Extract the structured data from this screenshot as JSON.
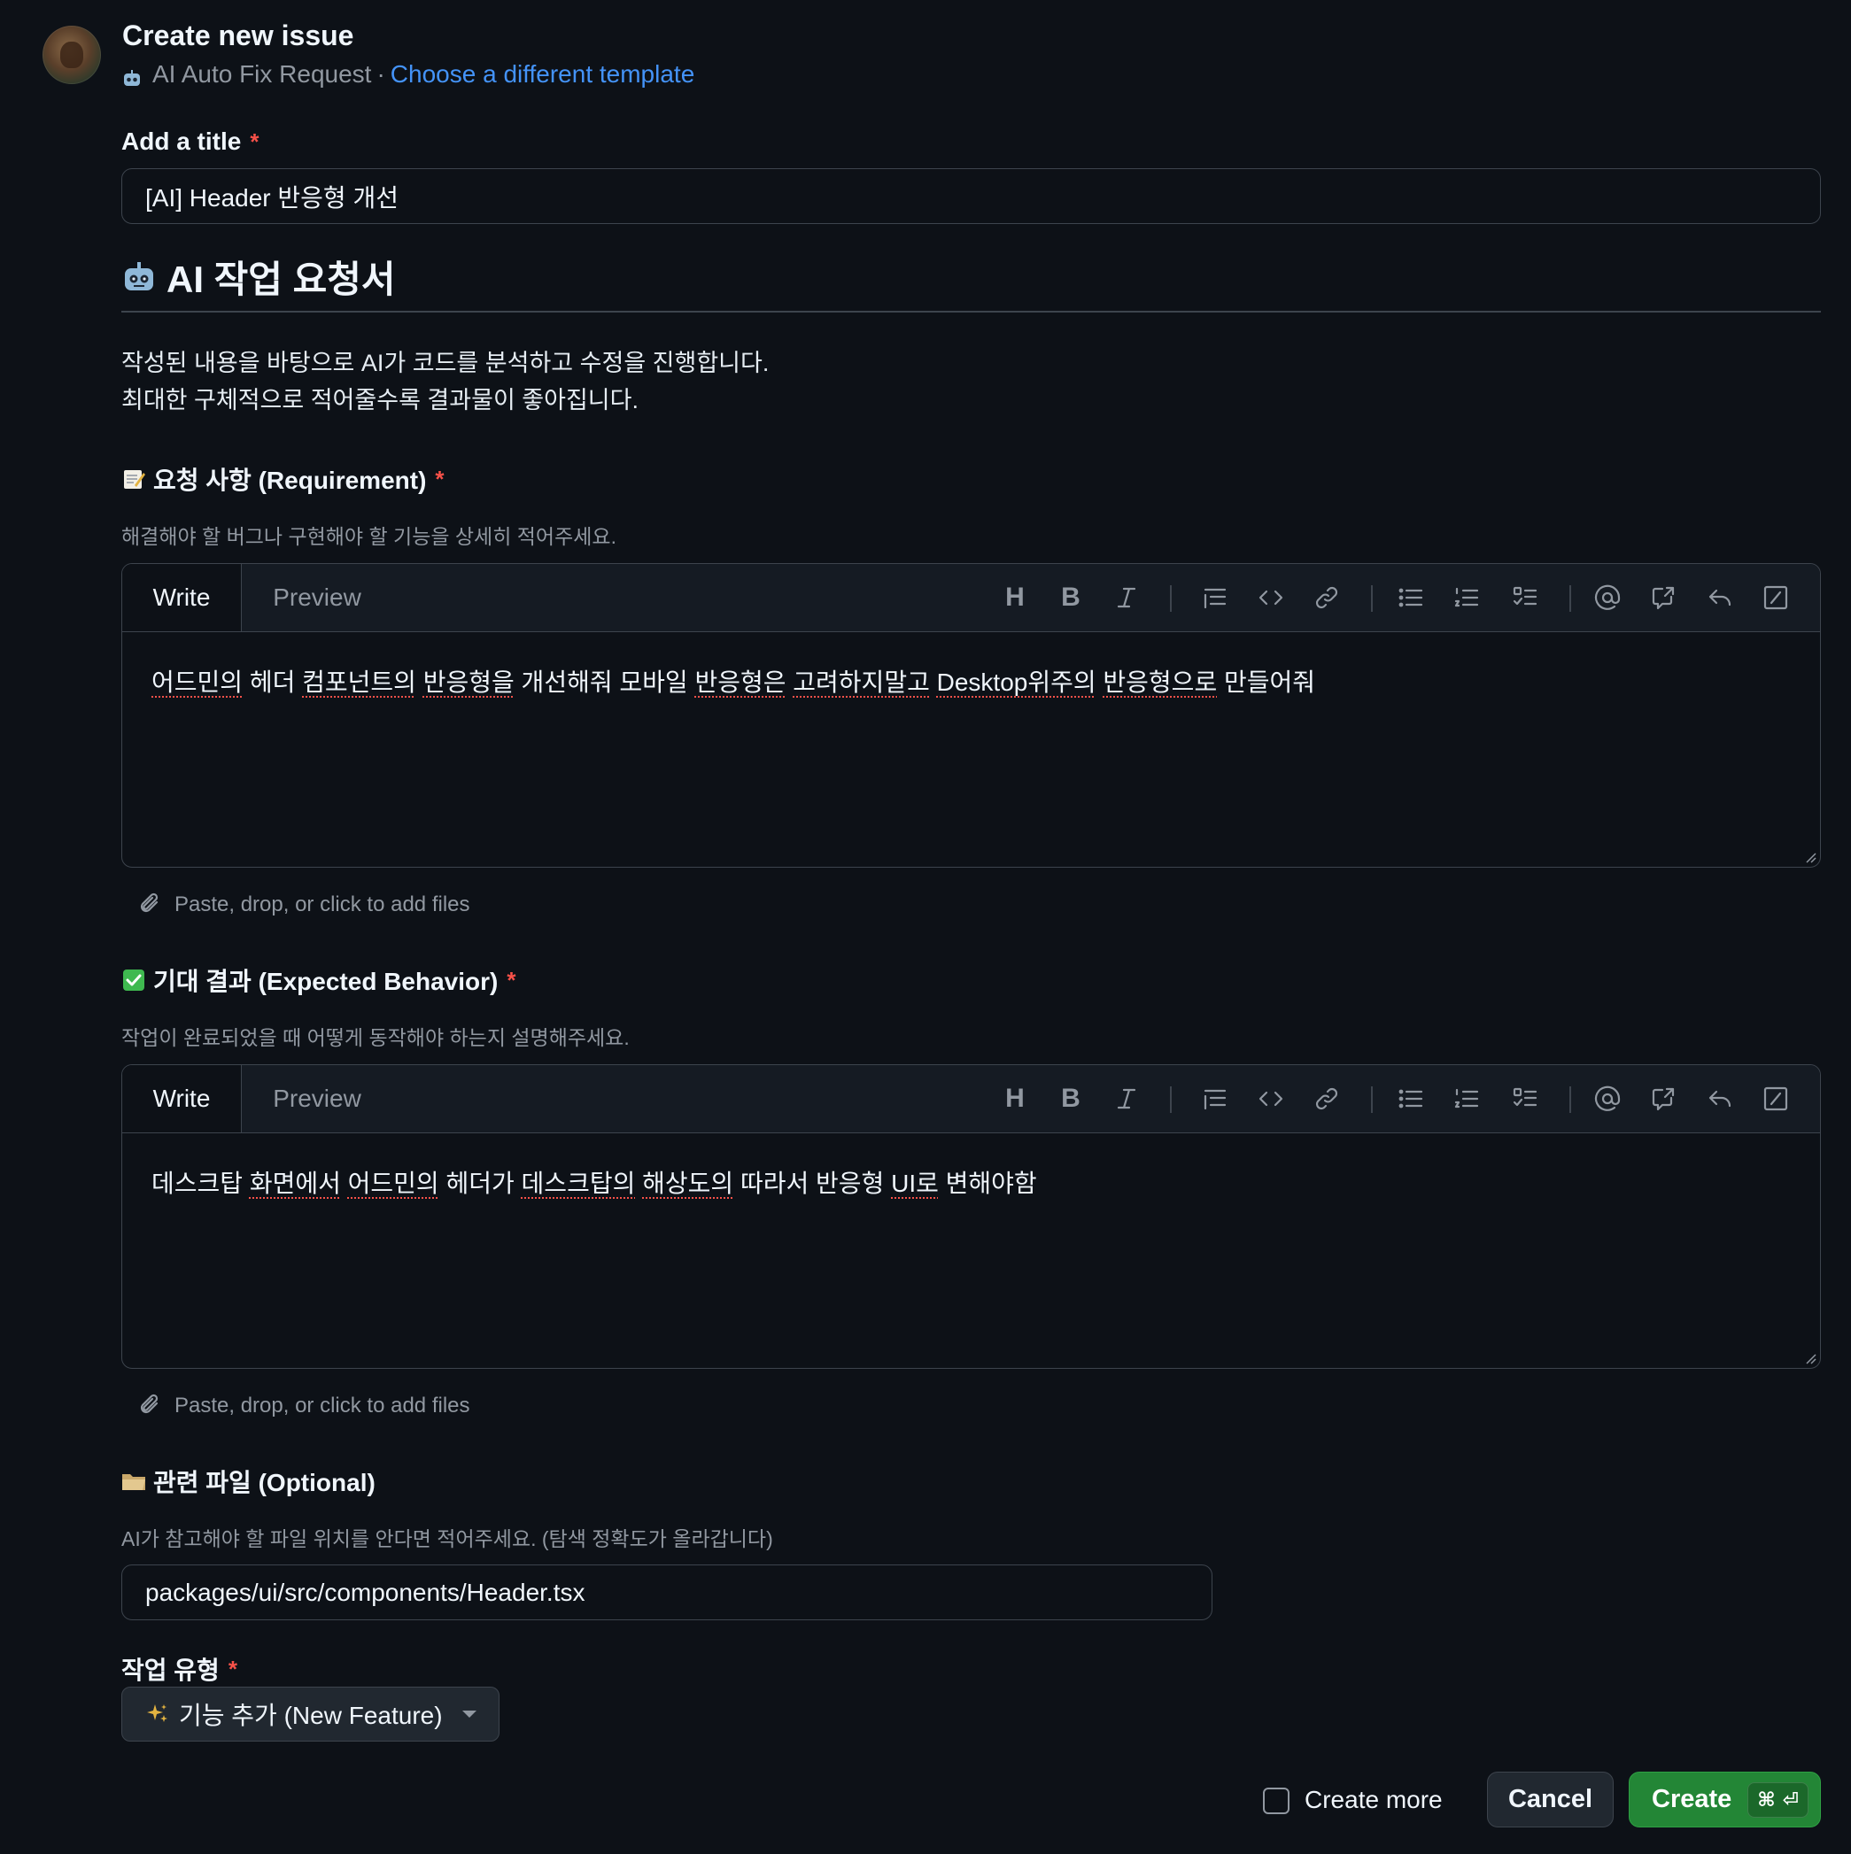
{
  "header": {
    "title": "Create new issue",
    "template_name": "AI Auto Fix Request",
    "separator": "·",
    "change_template_link": "Choose a different template"
  },
  "title_field": {
    "label": "Add a title",
    "required_mark": "*",
    "value": "[AI] Header 반응형 개선"
  },
  "intro": {
    "heading": "AI 작업 요청서",
    "line1": "작성된 내용을 바탕으로 AI가 코드를 분석하고 수정을 진행합니다.",
    "line2": "최대한 구체적으로 적어줄수록 결과물이 좋아집니다."
  },
  "requirement": {
    "label": "요청 사항 (Requirement)",
    "required_mark": "*",
    "hint": "해결해야 할 버그나 구현해야 할 기능을 상세히 적어주세요.",
    "tab_write": "Write",
    "tab_preview": "Preview",
    "body": {
      "w1": "어드민의",
      "w2": " 헤더 ",
      "w3": "컴포넌트의",
      "w4": " ",
      "w5": "반응형을",
      "w6": " 개선해줘 모바일 ",
      "w7": "반응형은",
      "w8": " ",
      "w9": "고려하지말고",
      "w10": " ",
      "w11": "Desktop위주의",
      "w12": " ",
      "w13": "반응형으로",
      "w14": " 만들어줘"
    },
    "attach_text": "Paste, drop, or click to add files"
  },
  "expected": {
    "label": "기대 결과 (Expected Behavior)",
    "required_mark": "*",
    "hint": "작업이 완료되었을 때 어떻게 동작해야 하는지 설명해주세요.",
    "tab_write": "Write",
    "tab_preview": "Preview",
    "body": {
      "w1": "데스크탑 ",
      "w2": "화면에서",
      "w3": " ",
      "w4": "어드민의",
      "w5": " 헤더가 ",
      "w6": "데스크탑의",
      "w7": " ",
      "w8": "해상도의",
      "w9": " 따라서 반응형 ",
      "w10": "UI로",
      "w11": " 변해야함"
    },
    "attach_text": "Paste, drop, or click to add files"
  },
  "files": {
    "label": "관련 파일 (Optional)",
    "hint": "AI가 참고해야 할 파일 위치를 안다면 적어주세요. (탐색 정확도가 올라갑니다)",
    "value": "packages/ui/src/components/Header.tsx"
  },
  "task_type": {
    "label": "작업 유형",
    "required_mark": "*",
    "selected": "기능 추가 (New Feature)"
  },
  "toolbar": {
    "heading": "H",
    "bold": "B"
  },
  "footer": {
    "create_more": "Create more",
    "cancel": "Cancel",
    "create": "Create",
    "shortcut_cmd": "⌘",
    "shortcut_enter": "⏎"
  },
  "colors": {
    "background": "#0d1117",
    "link": "#4493f8",
    "required": "#f85149",
    "primary_button": "#238636"
  }
}
